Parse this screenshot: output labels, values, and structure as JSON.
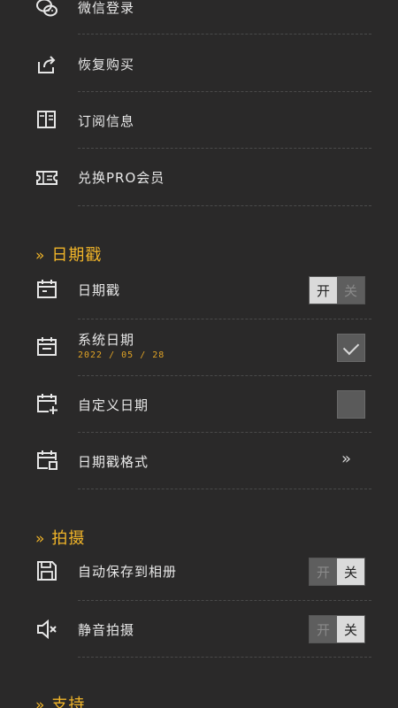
{
  "account": {
    "items": [
      {
        "label": "微信登录",
        "icon": "wechat-icon"
      },
      {
        "label": "恢复购买",
        "icon": "share-icon"
      },
      {
        "label": "订阅信息",
        "icon": "book-icon"
      },
      {
        "label": "兑换PRO会员",
        "icon": "ticket-icon"
      }
    ]
  },
  "date_stamp": {
    "title": "日期戳",
    "chevron": "»",
    "toggle_row": {
      "label": "日期戳",
      "on_label": "开",
      "off_label": "关",
      "state": "on",
      "icon": "calendar-icon"
    },
    "system_date": {
      "label": "系统日期",
      "value": "2022 / 05 / 28",
      "checked": true,
      "icon": "calendar-icon"
    },
    "custom_date": {
      "label": "自定义日期",
      "checked": false,
      "icon": "calendar-plus-icon"
    },
    "format": {
      "label": "日期戳格式",
      "arrow": "»",
      "icon": "calendar-settings-icon"
    }
  },
  "shooting": {
    "title": "拍摄",
    "chevron": "»",
    "auto_save": {
      "label": "自动保存到相册",
      "on_label": "开",
      "off_label": "关",
      "state": "off",
      "icon": "save-icon"
    },
    "silent": {
      "label": "静音拍摄",
      "on_label": "开",
      "off_label": "关",
      "state": "off",
      "icon": "mute-icon"
    }
  },
  "support": {
    "title": "支持",
    "chevron": "»"
  },
  "colors": {
    "background": "#2a2929",
    "accent": "#f0b429",
    "text": "#e8e8e8"
  }
}
